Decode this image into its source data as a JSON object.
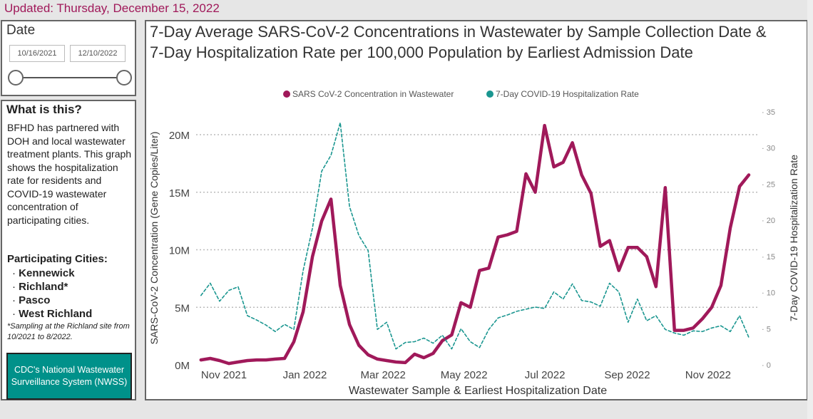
{
  "updated": "Updated: Thursday, December 15, 2022",
  "date_filter": {
    "label": "Date",
    "start": "10/16/2021",
    "end": "12/10/2022"
  },
  "info": {
    "heading": "What is this?",
    "description": "BFHD has partnered with DOH and local wastewater treatment plants. This graph shows the hospitalization rate for residents and COVID-19 wastewater concentration of participating cities.",
    "cities_heading": "Participating Cities:",
    "cities": [
      "Kennewick",
      "Richland*",
      "Pasco",
      "West Richland"
    ],
    "note": "*Sampling at the Richland site from 10/2021 to 8/2022.",
    "nwss_button": "CDC's National Wastewater Surveillance System (NWSS)"
  },
  "chart_data": {
    "type": "line",
    "title": "7-Day Average SARS-CoV-2 Concentrations in Wastewater by Sample Collection Date & 7-Day Hospitalization Rate per 100,000 Population by Earliest Admission Date",
    "xlabel": "Wastewater Sample & Earliest Hospitalization Date",
    "ylabel": "SARS-CoV-2 Concentration (Gene Copies/Liter)",
    "y2label": "7-Day COVID-19 Hospitalization Rate",
    "legend_position": "top",
    "grid": true,
    "x_ticks": [
      {
        "date": "2021-11-01",
        "label": "Nov 2021"
      },
      {
        "date": "2022-01-01",
        "label": "Jan 2022"
      },
      {
        "date": "2022-03-01",
        "label": "Mar 2022"
      },
      {
        "date": "2022-05-01",
        "label": "May 2022"
      },
      {
        "date": "2022-07-01",
        "label": "Jul 2022"
      },
      {
        "date": "2022-09-01",
        "label": "Sep 2022"
      },
      {
        "date": "2022-11-01",
        "label": "Nov 2022"
      }
    ],
    "y_ticks": [
      {
        "v": 0,
        "label": "0M"
      },
      {
        "v": 5000000,
        "label": "5M"
      },
      {
        "v": 10000000,
        "label": "10M"
      },
      {
        "v": 15000000,
        "label": "15M"
      },
      {
        "v": 20000000,
        "label": "20M"
      }
    ],
    "y2_ticks": [
      0,
      5,
      10,
      15,
      20,
      25,
      30,
      35
    ],
    "ylim": [
      0,
      20000000
    ],
    "y2lim": [
      0,
      35
    ],
    "x": [
      "2021-10-19",
      "2021-10-26",
      "2021-11-02",
      "2021-11-09",
      "2021-11-16",
      "2021-11-23",
      "2021-11-30",
      "2021-12-07",
      "2021-12-14",
      "2021-12-21",
      "2021-12-28",
      "2022-01-04",
      "2022-01-11",
      "2022-01-18",
      "2022-01-25",
      "2022-02-01",
      "2022-02-08",
      "2022-02-15",
      "2022-02-22",
      "2022-03-01",
      "2022-03-08",
      "2022-03-15",
      "2022-03-22",
      "2022-03-29",
      "2022-04-05",
      "2022-04-12",
      "2022-04-19",
      "2022-04-26",
      "2022-05-03",
      "2022-05-10",
      "2022-05-17",
      "2022-05-24",
      "2022-05-31",
      "2022-06-07",
      "2022-06-14",
      "2022-06-21",
      "2022-06-28",
      "2022-07-05",
      "2022-07-12",
      "2022-07-19",
      "2022-07-26",
      "2022-08-02",
      "2022-08-09",
      "2022-08-16",
      "2022-08-23",
      "2022-08-30",
      "2022-09-06",
      "2022-09-13",
      "2022-09-20",
      "2022-09-27",
      "2022-10-04",
      "2022-10-11",
      "2022-10-18",
      "2022-10-25",
      "2022-11-01",
      "2022-11-08",
      "2022-11-15",
      "2022-11-22",
      "2022-11-29",
      "2022-12-06"
    ],
    "series": [
      {
        "name": "SARS CoV-2 Concentration in Wastewater",
        "axis": "left",
        "color": "#a0195a",
        "style": "solid",
        "values": [
          430000,
          560000,
          370000,
          120000,
          250000,
          370000,
          430000,
          430000,
          500000,
          560000,
          2000000,
          4600000,
          9400000,
          12500000,
          14400000,
          6900000,
          3500000,
          1700000,
          870000,
          500000,
          370000,
          250000,
          190000,
          930000,
          620000,
          990000,
          2100000,
          2600000,
          5400000,
          5000000,
          8200000,
          8400000,
          11100000,
          11300000,
          11600000,
          16600000,
          15000000,
          20800000,
          17200000,
          17600000,
          19300000,
          16500000,
          14900000,
          10300000,
          10800000,
          8200000,
          10200000,
          10200000,
          9400000,
          6800000,
          15400000,
          3000000,
          3000000,
          3200000,
          4000000,
          5000000,
          6900000,
          11900000,
          15500000,
          16500000
        ]
      },
      {
        "name": "7-Day COVID-19 Hospitalization Rate",
        "axis": "right",
        "color": "#1a9690",
        "style": "dashed",
        "values": [
          9.6,
          11.3,
          8.8,
          10.3,
          10.8,
          6.8,
          6.2,
          5.5,
          4.6,
          5.6,
          4.9,
          13.0,
          18.9,
          26.8,
          29.0,
          33.5,
          21.9,
          17.9,
          15.8,
          4.9,
          5.9,
          2.2,
          3.1,
          3.2,
          3.7,
          3.0,
          4.1,
          2.2,
          5.0,
          3.2,
          2.4,
          4.9,
          6.5,
          6.9,
          7.4,
          7.7,
          8.0,
          7.8,
          10.1,
          9.1,
          11.2,
          8.9,
          8.7,
          8.1,
          11.3,
          10.1,
          5.9,
          9.1,
          6.1,
          6.8,
          4.9,
          4.4,
          4.1,
          4.7,
          4.6,
          5.1,
          5.4,
          4.6,
          6.8,
          3.8
        ]
      }
    ]
  }
}
